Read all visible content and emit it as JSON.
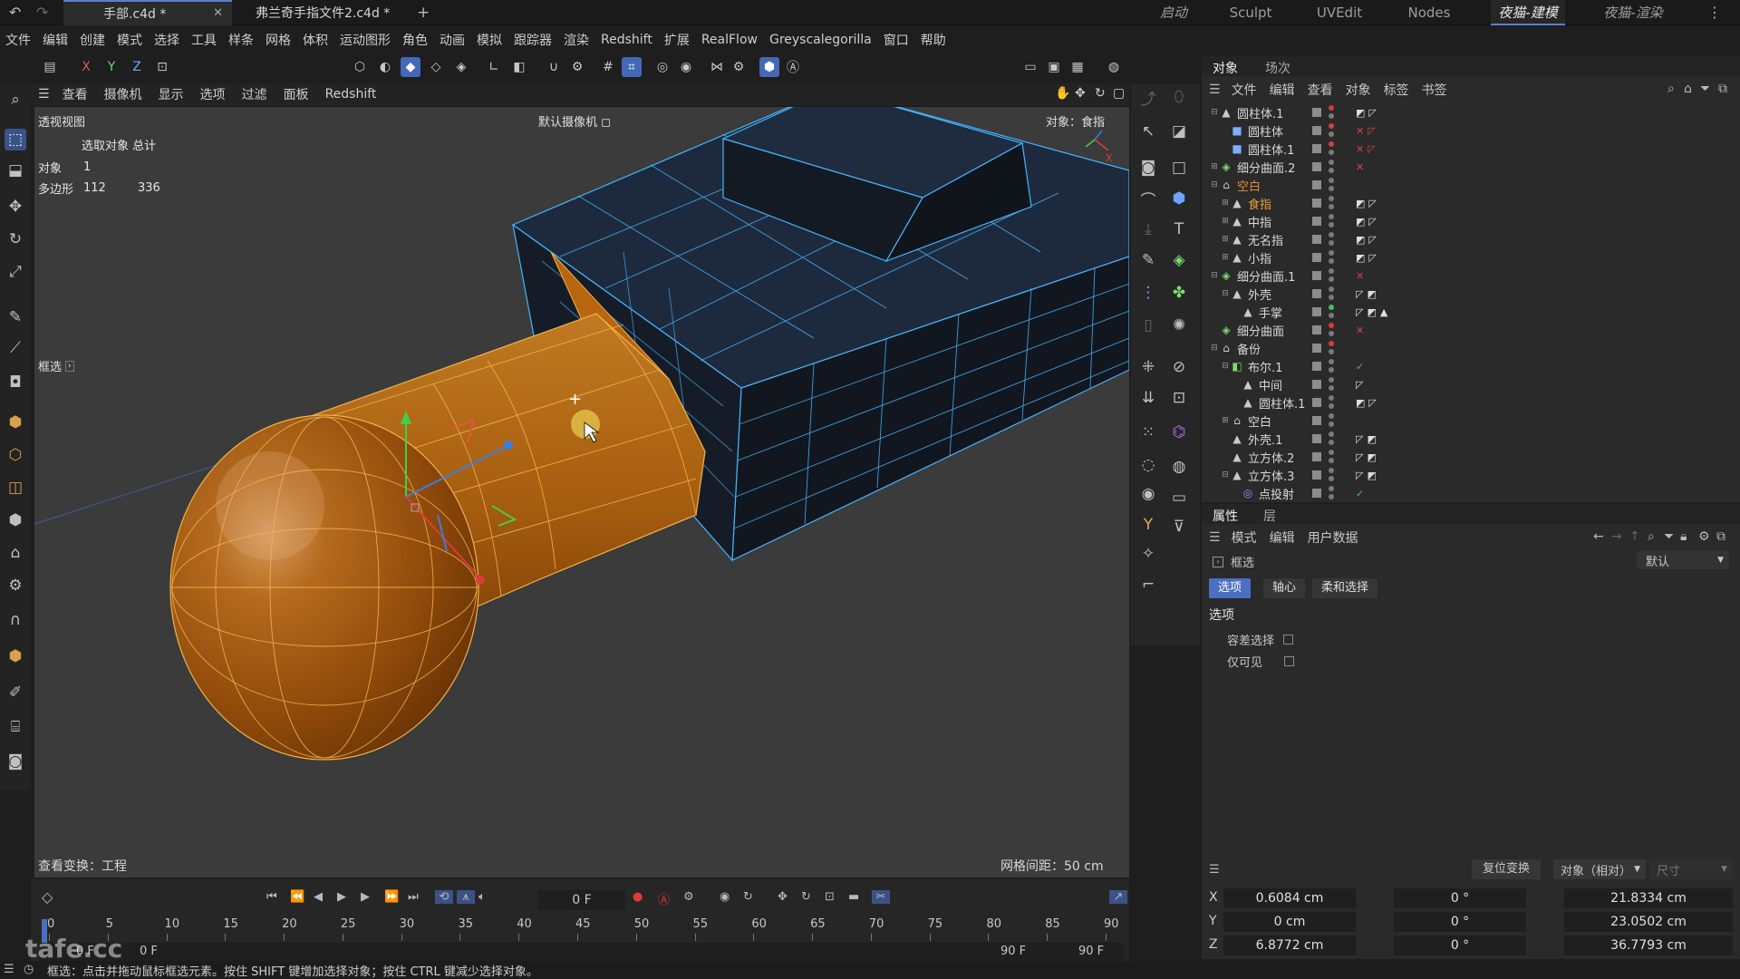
{
  "doc_tabs": [
    "手部.c4d *",
    "弗兰奇手指文件2.c4d *"
  ],
  "layout_tabs": [
    "启动",
    "Sculpt",
    "UVEdit",
    "Nodes",
    "夜猫-建模",
    "夜猫-渲染"
  ],
  "menu": [
    "文件",
    "编辑",
    "创建",
    "模式",
    "选择",
    "工具",
    "样条",
    "网格",
    "体积",
    "运动图形",
    "角色",
    "动画",
    "模拟",
    "跟踪器",
    "渲染",
    "Redshift",
    "扩展",
    "RealFlow",
    "Greyscalegorilla",
    "窗口",
    "帮助"
  ],
  "viewport": {
    "menu": [
      "查看",
      "摄像机",
      "显示",
      "选项",
      "过滤",
      "面板",
      "Redshift"
    ],
    "label": "透视视图",
    "camera": "默认摄像机 ◻",
    "focus": "对象：食指",
    "stats_header": "选取对象 总计",
    "stats": [
      {
        "label": "对象",
        "sel": "1",
        "total": ""
      },
      {
        "label": "多边形",
        "sel": "112",
        "total": "336"
      }
    ],
    "selection_tool": "框选",
    "view_transform": "查看变换：工程",
    "grid_spacing": "网格间距：50 cm"
  },
  "object_manager": {
    "tabs": [
      "对象",
      "场次"
    ],
    "menu": [
      "文件",
      "编辑",
      "查看",
      "对象",
      "标签",
      "书签"
    ],
    "rows": [
      {
        "name": "圆柱体.1",
        "level": 0,
        "expand": "⊟",
        "icon": "▲",
        "icolor": "#c9c9c9",
        "dot": "#d04040",
        "tags": "◩◸"
      },
      {
        "name": "圆柱体",
        "level": 1,
        "expand": "",
        "icon": "■",
        "icolor": "#7ab0ff",
        "dot": "#d04040",
        "tags": "✕◸"
      },
      {
        "name": "圆柱体.1",
        "level": 1,
        "expand": "",
        "icon": "■",
        "icolor": "#7ab0ff",
        "dot": "#d04040",
        "tags": "✕◸"
      },
      {
        "name": "细分曲面.2",
        "level": 0,
        "expand": "⊞",
        "icon": "◈",
        "icolor": "#7fdc6f",
        "dot": "#7a7a7a",
        "tags": "✕"
      },
      {
        "name": "空白",
        "level": 0,
        "expand": "⊟",
        "icon": "⌂",
        "icolor": "#c9c9c9",
        "dot": "#7a7a7a",
        "tags": "",
        "color": "#e08a3a"
      },
      {
        "name": "食指",
        "level": 1,
        "expand": "⊞",
        "icon": "▲",
        "icolor": "#c9c9c9",
        "dot": "#7a7a7a",
        "tags": "◩◸",
        "color": "#e8a23a"
      },
      {
        "name": "中指",
        "level": 1,
        "expand": "⊞",
        "icon": "▲",
        "icolor": "#c9c9c9",
        "dot": "#7a7a7a",
        "tags": "◩◸"
      },
      {
        "name": "无名指",
        "level": 1,
        "expand": "⊞",
        "icon": "▲",
        "icolor": "#c9c9c9",
        "dot": "#7a7a7a",
        "tags": "◩◸"
      },
      {
        "name": "小指",
        "level": 1,
        "expand": "⊞",
        "icon": "▲",
        "icolor": "#c9c9c9",
        "dot": "#7a7a7a",
        "tags": "◩◸"
      },
      {
        "name": "细分曲面.1",
        "level": 0,
        "expand": "⊟",
        "icon": "◈",
        "icolor": "#7fdc6f",
        "dot": "#7a7a7a",
        "tags": "✕"
      },
      {
        "name": "外壳",
        "level": 1,
        "expand": "⊟",
        "icon": "▲",
        "icolor": "#c9c9c9",
        "dot": "#7a7a7a",
        "tags": "◸◩"
      },
      {
        "name": "手掌",
        "level": 2,
        "expand": "",
        "icon": "▲",
        "icolor": "#c9c9c9",
        "dot": "#44c060",
        "tags": "◸◩▲"
      },
      {
        "name": "细分曲面",
        "level": 0,
        "expand": "",
        "icon": "◈",
        "icolor": "#7fdc6f",
        "dot": "#d04040",
        "tags": "✕"
      },
      {
        "name": "备份",
        "level": 0,
        "expand": "⊟",
        "icon": "⌂",
        "icolor": "#c9c9c9",
        "dot": "#d04040",
        "tags": ""
      },
      {
        "name": "布尔.1",
        "level": 1,
        "expand": "⊟",
        "icon": "◧",
        "icolor": "#7fdc6f",
        "dot": "#7a7a7a",
        "tags": "✓"
      },
      {
        "name": "中间",
        "level": 2,
        "expand": "",
        "icon": "▲",
        "icolor": "#c9c9c9",
        "dot": "#7a7a7a",
        "tags": "◸"
      },
      {
        "name": "圆柱体.1",
        "level": 2,
        "expand": "",
        "icon": "▲",
        "icolor": "#c9c9c9",
        "dot": "#7a7a7a",
        "tags": "◩◸"
      },
      {
        "name": "空白",
        "level": 1,
        "expand": "⊞",
        "icon": "⌂",
        "icolor": "#c9c9c9",
        "dot": "#7a7a7a",
        "tags": ""
      },
      {
        "name": "外壳.1",
        "level": 1,
        "expand": "",
        "icon": "▲",
        "icolor": "#c9c9c9",
        "dot": "#7a7a7a",
        "tags": "◸◩"
      },
      {
        "name": "立方体.2",
        "level": 1,
        "expand": "",
        "icon": "▲",
        "icolor": "#c9c9c9",
        "dot": "#7a7a7a",
        "tags": "◸◩"
      },
      {
        "name": "立方体.3",
        "level": 1,
        "expand": "⊟",
        "icon": "▲",
        "icolor": "#c9c9c9",
        "dot": "#7a7a7a",
        "tags": "◸◩"
      },
      {
        "name": "点投射",
        "level": 2,
        "expand": "",
        "icon": "◎",
        "icolor": "#9f8cff",
        "dot": "#7a7a7a",
        "tags": "✓"
      }
    ]
  },
  "attributes": {
    "tabs": [
      "属性",
      "层"
    ],
    "menu": [
      "模式",
      "编辑",
      "用户数据"
    ],
    "tool_name": "框选",
    "preset": "默认",
    "subtabs": [
      "选项",
      "轴心",
      "柔和选择"
    ],
    "section": "选项",
    "options": [
      {
        "label": "容差选择",
        "checked": false
      },
      {
        "label": "仅可见",
        "checked": false
      }
    ]
  },
  "coordinates": {
    "reset_button": "复位变换",
    "mode": "对象（相对）",
    "size_label": "尺寸",
    "rows": [
      {
        "axis": "X",
        "pos": "0.6084 cm",
        "rot": "0 °",
        "size": "21.8334 cm"
      },
      {
        "axis": "Y",
        "pos": "0 cm",
        "rot": "0 °",
        "size": "23.0502 cm"
      },
      {
        "axis": "Z",
        "pos": "6.8772 cm",
        "rot": "0 °",
        "size": "36.7793 cm"
      }
    ]
  },
  "timeline": {
    "current_frame": "0 F",
    "ticks": [
      "0",
      "5",
      "10",
      "15",
      "20",
      "25",
      "30",
      "35",
      "40",
      "45",
      "50",
      "55",
      "60",
      "65",
      "70",
      "75",
      "80",
      "85",
      "90"
    ],
    "start": "0 F",
    "start2": "0 F",
    "end": "90 F",
    "end2": "90 F"
  },
  "status": "框选：点击并拖动鼠标框选元素。按住 SHIFT 键增加选择对象；按住 CTRL 键减少选择对象。",
  "watermark": "tafe.cc",
  "colors": {
    "accent": "#4a6fc3",
    "selection_orange": "#d58a1c",
    "mesh_blue": "#46b4ff"
  }
}
